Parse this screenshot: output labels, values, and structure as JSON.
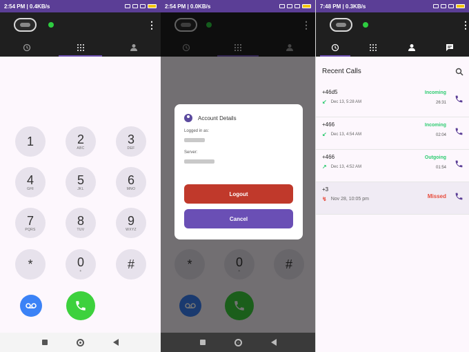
{
  "screens": [
    {
      "status": {
        "time": "2:54 PM | 0.4KB/s"
      },
      "keypad": [
        {
          "digit": "1",
          "letters": ""
        },
        {
          "digit": "2",
          "letters": "ABC"
        },
        {
          "digit": "3",
          "letters": "DEF"
        },
        {
          "digit": "4",
          "letters": "GHI"
        },
        {
          "digit": "5",
          "letters": "JKL"
        },
        {
          "digit": "6",
          "letters": "MNO"
        },
        {
          "digit": "7",
          "letters": "PQRS"
        },
        {
          "digit": "8",
          "letters": "TUV"
        },
        {
          "digit": "9",
          "letters": "WXYZ"
        },
        {
          "digit": "*",
          "letters": ""
        },
        {
          "digit": "0",
          "letters": "+"
        },
        {
          "digit": "#",
          "letters": ""
        }
      ]
    },
    {
      "status": {
        "time": "2:54 PM | 0.0KB/s"
      },
      "dialog": {
        "title": "Account Details",
        "logged_in_label": "Logged in as:",
        "server_label": "Server:",
        "logout": "Logout",
        "cancel": "Cancel"
      }
    },
    {
      "status": {
        "time": "7:48 PM | 0.3KB/s"
      },
      "title": "Recent Calls",
      "calls": [
        {
          "number": "+46d5",
          "date": "Dec 13, 5:28 AM",
          "status": "Incoming",
          "duration": "26:31",
          "color": "#2ecc71"
        },
        {
          "number": "+466",
          "date": "Dec 13, 4:54 AM",
          "status": "Incoming",
          "duration": "02:04",
          "color": "#2ecc71"
        },
        {
          "number": "+466",
          "date": "Dec 13, 4:52 AM",
          "status": "Outgoing",
          "duration": "01:54",
          "color": "#2ecc71"
        },
        {
          "number": "+3",
          "date": "Nov 28, 10:05 pm",
          "status": "Missed",
          "duration": "",
          "color": "#e74c3c"
        }
      ]
    }
  ],
  "colors": {
    "accent": "#5b3e96",
    "call_green": "#3dd13d",
    "logout_red": "#c0392b",
    "cancel_purple": "#6a4fb5"
  }
}
